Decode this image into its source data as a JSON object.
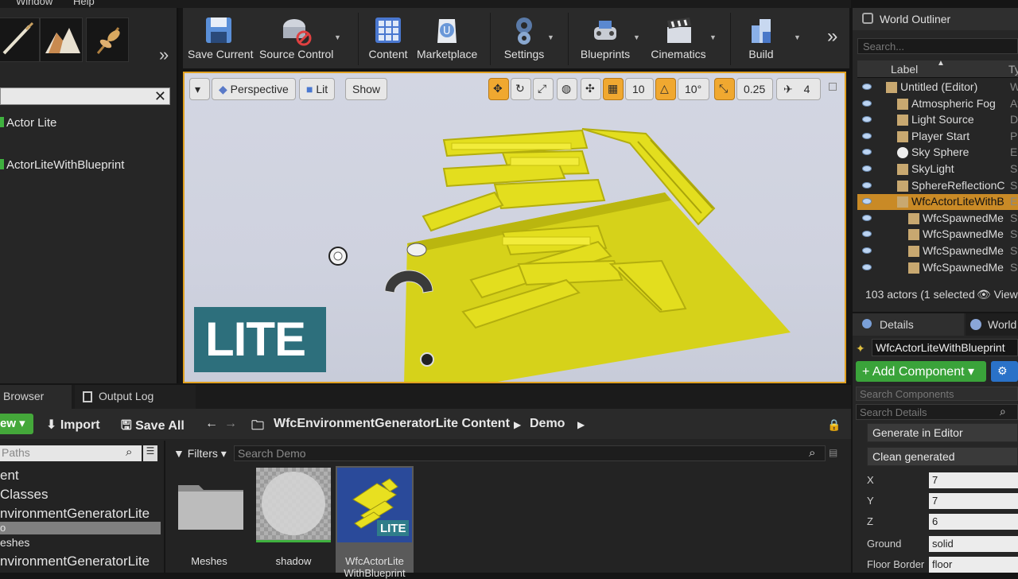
{
  "menu": {
    "window": "Window",
    "help": "Help"
  },
  "place_items": [
    "Actor Lite",
    "ActorLiteWithBlueprint"
  ],
  "toolbar": {
    "save_current": "Save Current",
    "source_control": "Source Control",
    "content": "Content",
    "marketplace": "Marketplace",
    "settings": "Settings",
    "blueprints": "Blueprints",
    "cinematics": "Cinematics",
    "build": "Build"
  },
  "viewport": {
    "perspective": "Perspective",
    "lit": "Lit",
    "show": "Show",
    "grid_snap": "10",
    "rot_snap": "10°",
    "scale_snap": "0.25",
    "cam_speed": "4",
    "badge": "LITE"
  },
  "outliner": {
    "title": "World Outliner",
    "search_placeholder": "Search...",
    "col_label": "Label",
    "col_type": "Ty",
    "rows": [
      {
        "label": "Untitled (Editor)",
        "type": "Wo"
      },
      {
        "label": "Atmospheric Fog",
        "type": "Atm"
      },
      {
        "label": "Light Source",
        "type": "Dir"
      },
      {
        "label": "Player Start",
        "type": "Pla"
      },
      {
        "label": "Sky Sphere",
        "type": "Ed"
      },
      {
        "label": "SkyLight",
        "type": "Sky"
      },
      {
        "label": "SphereReflectionC",
        "type": "Sph"
      },
      {
        "label": "WfcActorLiteWithB",
        "type": "Ed"
      },
      {
        "label": "WfcSpawnedMe",
        "type": "Sta"
      },
      {
        "label": "WfcSpawnedMe",
        "type": "Sta"
      },
      {
        "label": "WfcSpawnedMe",
        "type": "Sta"
      },
      {
        "label": "WfcSpawnedMe",
        "type": "Sta"
      }
    ],
    "status": "103 actors (1 selected",
    "view": "View"
  },
  "details": {
    "tab": "Details",
    "tab2": "World",
    "actor_name": "WfcActorLiteWithBlueprint",
    "add_component": "Add Component",
    "search_components": "Search Components",
    "search_details": "Search Details",
    "generate": "Generate in Editor",
    "clean": "Clean generated",
    "props": [
      {
        "label": "X",
        "value": "7"
      },
      {
        "label": "Y",
        "value": "7"
      },
      {
        "label": "Z",
        "value": "6"
      },
      {
        "label": "Ground",
        "value": "solid"
      },
      {
        "label": "Floor Border",
        "value": "floor"
      }
    ]
  },
  "content_browser": {
    "tab1": "Browser",
    "tab2": "Output Log",
    "add_new": "ew",
    "import": "Import",
    "save_all": "Save All",
    "path1": "WfcEnvironmentGeneratorLite Content",
    "path2": "Demo",
    "paths_placeholder": "Paths",
    "filters": "Filters",
    "search_placeholder": "Search Demo",
    "tree": [
      "ent",
      "Classes",
      "nvironmentGeneratorLite",
      "o",
      "eshes",
      "nvironmentGeneratorLite"
    ],
    "assets": [
      {
        "name": "Meshes"
      },
      {
        "name": "shadow"
      },
      {
        "name": "WfcActorLite WithBlueprint"
      }
    ],
    "asset_badge": "LITE"
  }
}
